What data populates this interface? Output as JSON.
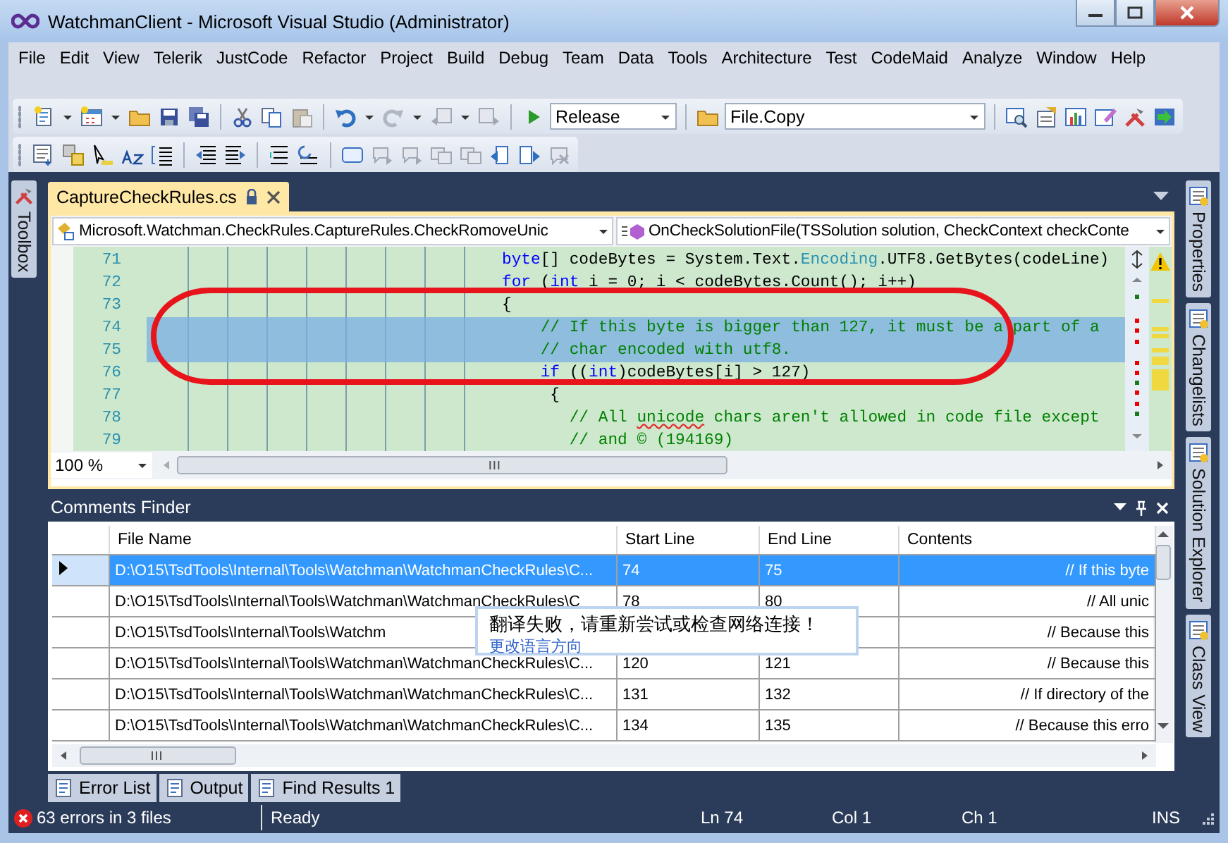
{
  "window": {
    "title": "WatchmanClient - Microsoft Visual Studio (Administrator)"
  },
  "menu": [
    "File",
    "Edit",
    "View",
    "Telerik",
    "JustCode",
    "Refactor",
    "Project",
    "Build",
    "Debug",
    "Team",
    "Data",
    "Tools",
    "Architecture",
    "Test",
    "CodeMaid",
    "Analyze",
    "Window",
    "Help"
  ],
  "toolbar": {
    "configuration": "Release",
    "find_box": "File.Copy"
  },
  "left_dock": [
    {
      "label": "Toolbox"
    }
  ],
  "right_dock": [
    {
      "label": "Properties"
    },
    {
      "label": "Changelists"
    },
    {
      "label": "Solution Explorer"
    },
    {
      "label": "Class View"
    }
  ],
  "document_tabs": [
    {
      "label": "CaptureCheckRules.cs",
      "selected": true,
      "locked": true
    }
  ],
  "editor": {
    "type_dropdown": "Microsoft.Watchman.CheckRules.CaptureRules.CheckRomoveUnic",
    "member_dropdown": "OnCheckSolutionFile(TSSolution solution, CheckContext checkConte",
    "zoom": "100 %",
    "lines": [
      {
        "number": "71",
        "selected": false,
        "tokens": [
          {
            "kind": "keyword",
            "text": "byte"
          },
          {
            "kind": "plain",
            "text": "[] codeBytes = System.Text."
          },
          {
            "kind": "type",
            "text": "Encoding"
          },
          {
            "kind": "plain",
            "text": ".UTF8.GetBytes(codeLine)"
          }
        ]
      },
      {
        "number": "72",
        "selected": false,
        "tokens": [
          {
            "kind": "keyword",
            "text": "for"
          },
          {
            "kind": "plain",
            "text": " ("
          },
          {
            "kind": "keyword",
            "text": "int"
          },
          {
            "kind": "plain",
            "text": " i = 0; i < codeBytes.Count(); i++)"
          }
        ]
      },
      {
        "number": "73",
        "selected": false,
        "tokens": [
          {
            "kind": "plain",
            "text": "{"
          }
        ]
      },
      {
        "number": "74",
        "selected": true,
        "tokens": [
          {
            "kind": "comment",
            "text": "    // If this byte is bigger than 127, it must be a part of a"
          }
        ]
      },
      {
        "number": "75",
        "selected": true,
        "tokens": [
          {
            "kind": "comment",
            "text": "    // char encoded with utf8."
          }
        ]
      },
      {
        "number": "76",
        "selected": false,
        "tokens": [
          {
            "kind": "keyword",
            "text": "    if"
          },
          {
            "kind": "plain",
            "text": " (("
          },
          {
            "kind": "keyword",
            "text": "int"
          },
          {
            "kind": "plain",
            "text": ")codeBytes[i] > 127)"
          }
        ]
      },
      {
        "number": "77",
        "selected": false,
        "tokens": [
          {
            "kind": "plain",
            "text": "     {"
          }
        ]
      },
      {
        "number": "78",
        "selected": false,
        "tokens": [
          {
            "kind": "comment",
            "text": "       // All "
          },
          {
            "kind": "misspelled",
            "text": "unicode"
          },
          {
            "kind": "comment",
            "text": " chars aren't allowed in code file except"
          }
        ]
      },
      {
        "number": "79",
        "selected": false,
        "tokens": [
          {
            "kind": "comment",
            "text": "       // and © (194169)"
          }
        ]
      }
    ]
  },
  "comments_finder": {
    "title": "Comments Finder",
    "columns": [
      "File Name",
      "Start Line",
      "End Line",
      "Contents"
    ],
    "rows": [
      {
        "selected": true,
        "file_name": "D:\\O15\\TsdTools\\Internal\\Tools\\Watchman\\WatchmanCheckRules\\C...",
        "start_line": "74",
        "end_line": "75",
        "contents": "// If this byte"
      },
      {
        "selected": false,
        "file_name": "D:\\O15\\TsdTools\\Internal\\Tools\\Watchman\\WatchmanCheckRules\\C",
        "start_line": "78",
        "end_line": "80",
        "contents": "// All unic"
      },
      {
        "selected": false,
        "file_name": "D:\\O15\\TsdTools\\Internal\\Tools\\Watchm",
        "contents": "// Because this"
      },
      {
        "selected": false,
        "file_name": "D:\\O15\\TsdTools\\Internal\\Tools\\Watchman\\WatchmanCheckRules\\C...",
        "start_line": "120",
        "end_line": "121",
        "contents": "// Because this"
      },
      {
        "selected": false,
        "file_name": "D:\\O15\\TsdTools\\Internal\\Tools\\Watchman\\WatchmanCheckRules\\C...",
        "start_line": "131",
        "end_line": "132",
        "contents": "// If directory of the"
      },
      {
        "selected": false,
        "file_name": "D:\\O15\\TsdTools\\Internal\\Tools\\Watchman\\WatchmanCheckRules\\C...",
        "start_line": "134",
        "end_line": "135",
        "contents": "// Because this erro"
      }
    ]
  },
  "translate_popup": {
    "message": "翻译失败，请重新尝试或检查网络连接！",
    "link": "更改语言方向"
  },
  "bottom_tabs": [
    {
      "label": "Error List"
    },
    {
      "label": "Output"
    },
    {
      "label": "Find Results 1"
    }
  ],
  "status_bar": {
    "errors": "63 errors in 3 files",
    "state": "Ready",
    "line": "Ln 74",
    "column": "Col 1",
    "char": "Ch 1",
    "mode": "INS"
  }
}
